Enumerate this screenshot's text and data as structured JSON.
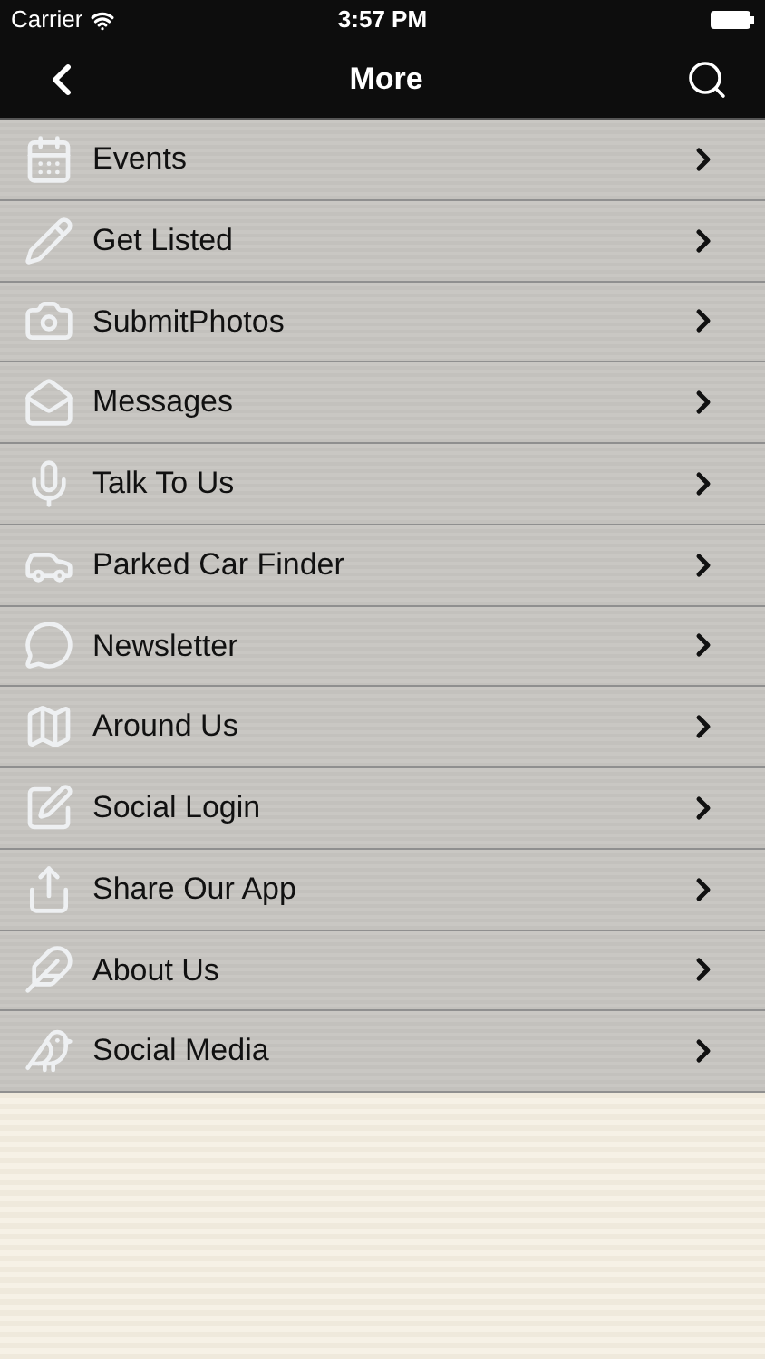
{
  "status_bar": {
    "carrier": "Carrier",
    "time": "3:57 PM"
  },
  "nav": {
    "title": "More"
  },
  "menu": [
    {
      "label": "Events",
      "kind": "calendar"
    },
    {
      "label": "Get Listed",
      "kind": "pencil"
    },
    {
      "label": "SubmitPhotos",
      "kind": "camera"
    },
    {
      "label": "Messages",
      "kind": "envelope"
    },
    {
      "label": "Talk To Us",
      "kind": "microphone"
    },
    {
      "label": "Parked Car Finder",
      "kind": "car"
    },
    {
      "label": "Newsletter",
      "kind": "chat"
    },
    {
      "label": "Around Us",
      "kind": "map"
    },
    {
      "label": "Social Login",
      "kind": "login"
    },
    {
      "label": "Share Our App",
      "kind": "share"
    },
    {
      "label": "About Us",
      "kind": "about"
    },
    {
      "label": "Social Media",
      "kind": "bird"
    }
  ]
}
